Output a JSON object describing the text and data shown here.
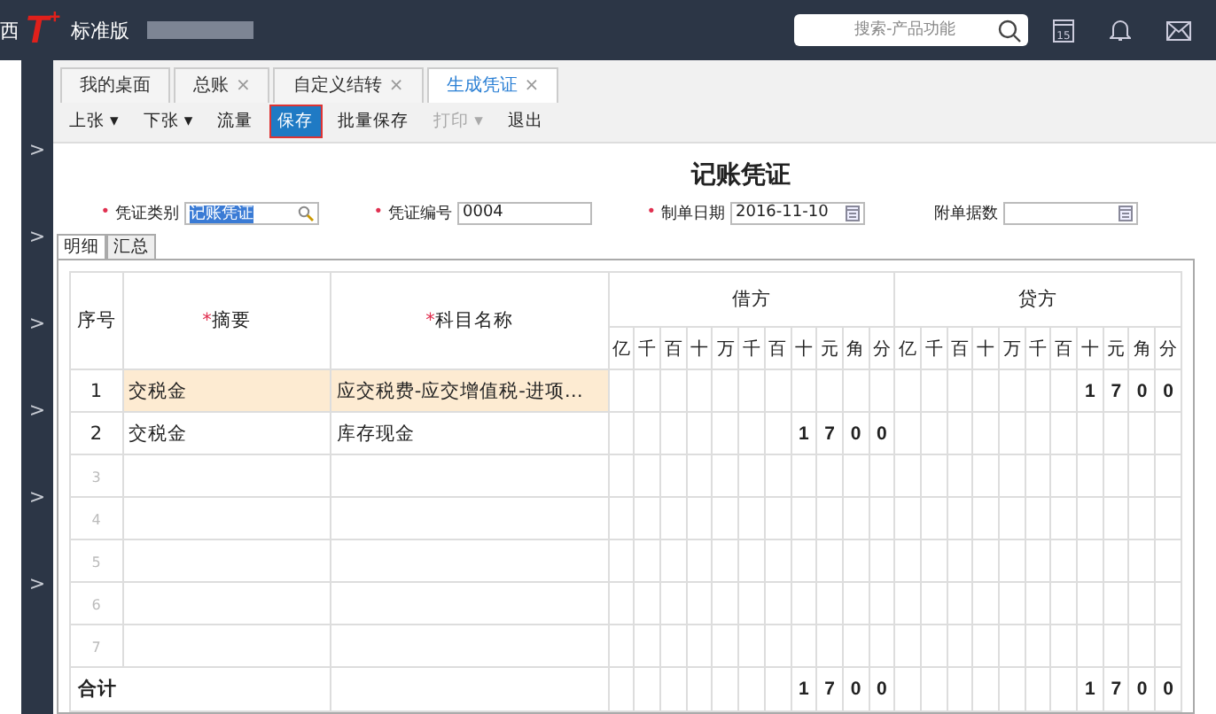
{
  "top_bar": {
    "logo_edge": "西",
    "logo": "T",
    "logo_sup": "+",
    "edition": "标准版",
    "search": {
      "placeholder": "搜索-产品功能"
    },
    "calendar_day": "15"
  },
  "sidebar": {
    "arrows": [
      ">",
      ">",
      ">",
      ">",
      ">",
      ">"
    ]
  },
  "tabs": [
    {
      "label": "我的桌面",
      "selected": false
    },
    {
      "label": "总账",
      "close": "×",
      "selected": false
    },
    {
      "label": "自定义结转",
      "close": "×",
      "selected": false
    },
    {
      "label": "生成凭证",
      "close": "×",
      "selected": true
    }
  ],
  "toolbar": [
    {
      "label": "上张",
      "caret": "▾",
      "selected": false,
      "disabled": false
    },
    {
      "label": "下张",
      "caret": "▾",
      "selected": false,
      "disabled": false
    },
    {
      "label": "流量",
      "selected": false,
      "disabled": false
    },
    {
      "label": "保存",
      "selected": true,
      "disabled": false
    },
    {
      "label": "批量保存",
      "selected": false,
      "disabled": false
    },
    {
      "label": "打印",
      "caret": "▾",
      "selected": false,
      "disabled": true
    },
    {
      "label": "退出",
      "selected": false,
      "disabled": false
    }
  ],
  "voucher": {
    "title": "记账凭证",
    "fields": [
      {
        "marker": "•",
        "label": "凭证类别",
        "value": "记账凭证",
        "kind": "lookup",
        "value_selected": true
      },
      {
        "marker": "•",
        "label": "凭证编号",
        "value": "0004",
        "kind": "text"
      },
      {
        "marker": "•",
        "label": "制单日期",
        "value": "2016-11-10",
        "kind": "date"
      },
      {
        "label": "附单据数",
        "kind": "date"
      }
    ],
    "subtabs": [
      {
        "label": "明细",
        "selected": true
      },
      {
        "label": "汇总",
        "selected": false
      }
    ],
    "table": {
      "columns": [
        {
          "label": "序号"
        },
        {
          "mark": "*",
          "label": "摘要"
        },
        {
          "mark": "*",
          "label": "科目名称"
        }
      ],
      "debit": {
        "label": "借方",
        "units": [
          "亿",
          "千",
          "百",
          "十",
          "万",
          "千",
          "百",
          "十",
          "元",
          "角",
          "分"
        ]
      },
      "credit": {
        "label": "贷方",
        "units": [
          "亿",
          "千",
          "百",
          "十",
          "万",
          "千",
          "百",
          "十",
          "元",
          "角",
          "分"
        ]
      },
      "rows": [
        {
          "no": "1",
          "summary": "交税金",
          "account": "应交税费-应交增值税-进项…",
          "debit": [],
          "credit": [
            "1",
            "7",
            "0",
            "0"
          ],
          "selected": true
        },
        {
          "no": "2",
          "summary": "交税金",
          "account": "库存现金",
          "debit": [
            "1",
            "7",
            "0",
            "0"
          ],
          "credit": [],
          "selected": false
        },
        {
          "no": "3",
          "debit": [],
          "credit": [],
          "selected": false
        },
        {
          "no": "4",
          "debit": [],
          "credit": [],
          "selected": false
        },
        {
          "no": "5",
          "debit": [],
          "credit": [],
          "selected": false
        },
        {
          "no": "6",
          "debit": [],
          "credit": [],
          "selected": false
        },
        {
          "no": "7",
          "debit": [],
          "credit": [],
          "selected": false
        }
      ],
      "total": {
        "label": "合计",
        "debit": [
          "1",
          "7",
          "0",
          "0"
        ],
        "credit": [
          "1",
          "7",
          "0",
          "0"
        ]
      }
    }
  }
}
